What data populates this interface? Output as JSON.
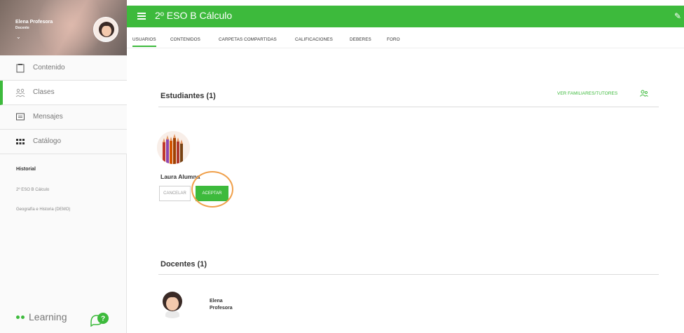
{
  "profile": {
    "name": "Elena Profesora",
    "role": "Docente"
  },
  "sidebar": {
    "items": [
      {
        "label": "Contenido",
        "icon": "content-icon"
      },
      {
        "label": "Clases",
        "icon": "classes-icon",
        "active": true
      },
      {
        "label": "Mensajes",
        "icon": "messages-icon"
      },
      {
        "label": "Catálogo",
        "icon": "catalog-icon"
      }
    ],
    "history_title": "Historial",
    "history": [
      "2º ESO B Cálculo",
      "Geografía e Historia (DEMO)"
    ],
    "brand": "Learning",
    "chat_badge": "?"
  },
  "header": {
    "title": "2º ESO B Cálculo"
  },
  "tabs": [
    "USUARIOS",
    "CONTENIDOS",
    "CARPETAS COMPARTIDAS",
    "CALIFICACIONES",
    "DEBERES",
    "FORO"
  ],
  "students": {
    "title": "Estudiantes (1)",
    "link": "VER FAMILIARES/TUTORES",
    "items": [
      {
        "name": "Laura Alumna"
      }
    ],
    "cancel_label": "CANCELAR",
    "accept_label": "ACEPTAR"
  },
  "teachers": {
    "title": "Docentes (1)",
    "items": [
      {
        "first": "Elena",
        "last": "Profesora"
      }
    ]
  },
  "colors": {
    "accent": "#3dba3c",
    "highlight": "#f0a04b"
  }
}
